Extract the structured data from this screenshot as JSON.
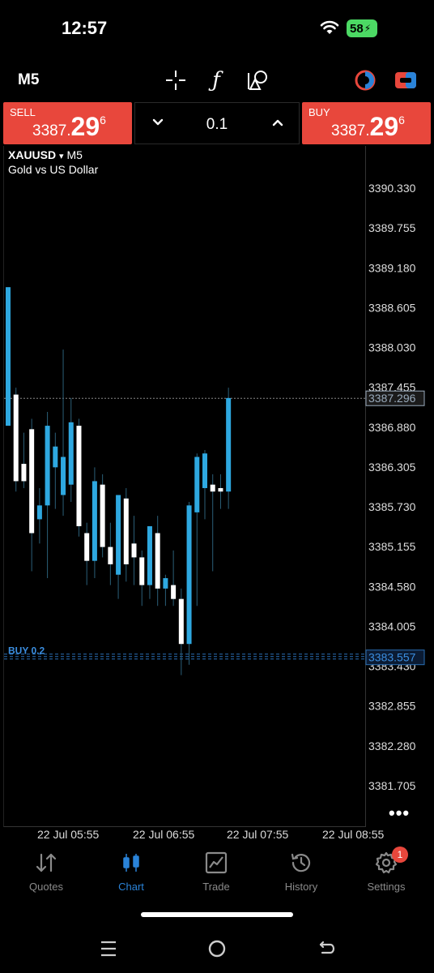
{
  "status": {
    "time": "12:57",
    "battery": "58"
  },
  "toolbar": {
    "timeframe": "M5"
  },
  "trade": {
    "sell_label": "SELL",
    "buy_label": "BUY",
    "sell_price": {
      "small": "3387.",
      "big": "29",
      "sup": "6"
    },
    "buy_price": {
      "small": "3387.",
      "big": "29",
      "sup": "6"
    },
    "volume": "0.1"
  },
  "chart": {
    "symbol": "XAUUSD",
    "symbol_arrow": "▾",
    "timeframe": "M5",
    "description": "Gold vs US Dollar",
    "more": "•••",
    "order_label": "BUY 0.2"
  },
  "chart_data": {
    "type": "candlestick",
    "y_ticks": [
      "3390.330",
      "3389.755",
      "3389.180",
      "3388.605",
      "3388.030",
      "3387.455",
      "3386.880",
      "3386.305",
      "3385.730",
      "3385.155",
      "3384.580",
      "3384.005",
      "3383.430",
      "3382.855",
      "3382.280",
      "3381.705"
    ],
    "x_ticks": [
      "22 Jul 05:55",
      "22 Jul 06:55",
      "22 Jul 07:55",
      "22 Jul 08:55"
    ],
    "current_price": "3387.296",
    "order_price": "3383.557",
    "ylim": [
      3381.3,
      3390.6
    ],
    "colors": {
      "up": "#2ea8e0",
      "down": "#ffffff",
      "wick": "#2b5f78"
    },
    "candles": [
      {
        "o": 3386.9,
        "h": 3388.9,
        "l": 3387.4,
        "c": 3388.9
      },
      {
        "o": 3387.35,
        "h": 3387.45,
        "l": 3385.95,
        "c": 3386.1
      },
      {
        "o": 3386.35,
        "h": 3386.8,
        "l": 3386.0,
        "c": 3386.1
      },
      {
        "o": 3386.85,
        "h": 3387.0,
        "l": 3384.8,
        "c": 3385.35
      },
      {
        "o": 3385.55,
        "h": 3386.0,
        "l": 3385.2,
        "c": 3385.75
      },
      {
        "o": 3385.75,
        "h": 3387.1,
        "l": 3384.7,
        "c": 3386.9
      },
      {
        "o": 3386.3,
        "h": 3386.8,
        "l": 3385.7,
        "c": 3386.6
      },
      {
        "o": 3385.9,
        "h": 3388.0,
        "l": 3385.6,
        "c": 3386.45
      },
      {
        "o": 3386.05,
        "h": 3387.3,
        "l": 3385.8,
        "c": 3386.95
      },
      {
        "o": 3386.9,
        "h": 3387.0,
        "l": 3385.3,
        "c": 3385.45
      },
      {
        "o": 3385.35,
        "h": 3385.5,
        "l": 3384.6,
        "c": 3384.95
      },
      {
        "o": 3384.95,
        "h": 3386.3,
        "l": 3384.7,
        "c": 3386.1
      },
      {
        "o": 3386.05,
        "h": 3386.2,
        "l": 3385.0,
        "c": 3385.15
      },
      {
        "o": 3385.15,
        "h": 3385.5,
        "l": 3384.6,
        "c": 3384.9
      },
      {
        "o": 3384.75,
        "h": 3385.9,
        "l": 3384.4,
        "c": 3385.9
      },
      {
        "o": 3385.85,
        "h": 3386.0,
        "l": 3384.65,
        "c": 3384.9
      },
      {
        "o": 3385.2,
        "h": 3385.6,
        "l": 3384.6,
        "c": 3385.0
      },
      {
        "o": 3385.0,
        "h": 3385.1,
        "l": 3384.3,
        "c": 3384.6
      },
      {
        "o": 3384.6,
        "h": 3385.3,
        "l": 3384.4,
        "c": 3385.45
      },
      {
        "o": 3385.35,
        "h": 3385.6,
        "l": 3384.3,
        "c": 3384.55
      },
      {
        "o": 3384.55,
        "h": 3384.75,
        "l": 3384.3,
        "c": 3384.7
      },
      {
        "o": 3384.6,
        "h": 3385.1,
        "l": 3384.3,
        "c": 3384.4
      },
      {
        "o": 3384.4,
        "h": 3384.55,
        "l": 3383.3,
        "c": 3383.75
      },
      {
        "o": 3383.75,
        "h": 3385.8,
        "l": 3383.45,
        "c": 3385.75
      },
      {
        "o": 3385.65,
        "h": 3386.5,
        "l": 3384.3,
        "c": 3386.45
      },
      {
        "o": 3386.0,
        "h": 3386.55,
        "l": 3385.55,
        "c": 3386.5
      },
      {
        "o": 3386.05,
        "h": 3386.2,
        "l": 3384.8,
        "c": 3385.95
      },
      {
        "o": 3386.0,
        "h": 3386.2,
        "l": 3385.7,
        "c": 3385.95
      },
      {
        "o": 3385.95,
        "h": 3387.45,
        "l": 3385.7,
        "c": 3387.3
      }
    ]
  },
  "nav": {
    "quotes": "Quotes",
    "chart": "Chart",
    "trade": "Trade",
    "history": "History",
    "settings": "Settings",
    "settings_badge": "1"
  }
}
